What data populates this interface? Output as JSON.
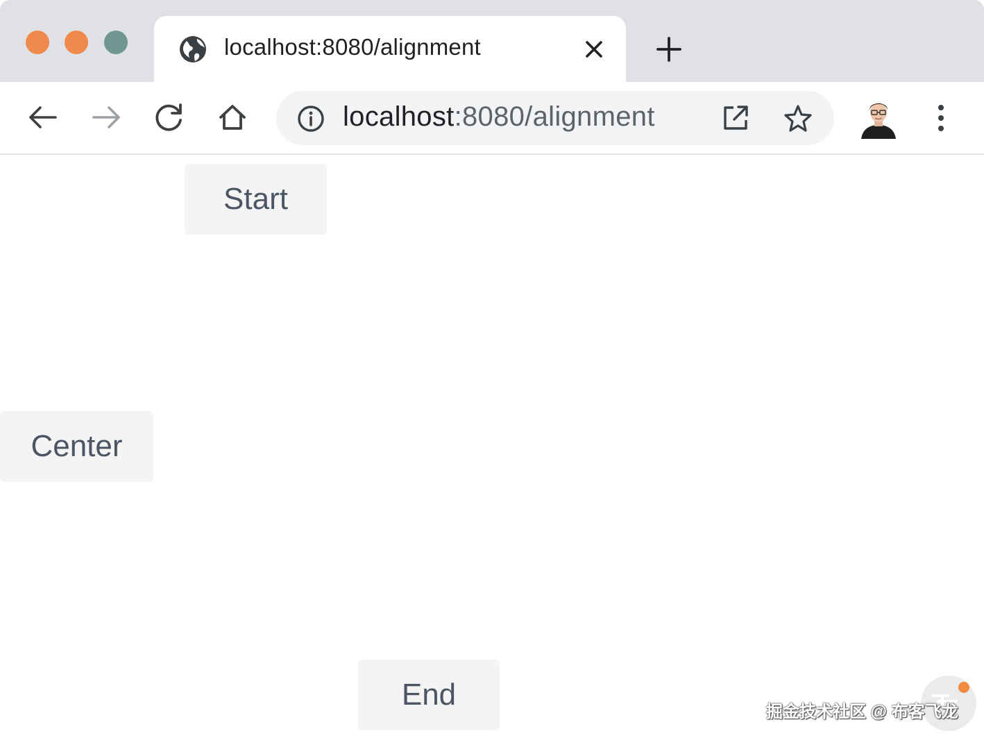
{
  "window": {
    "traffic_lights": [
      {
        "name": "close",
        "color": "#ef8a4c"
      },
      {
        "name": "minimize",
        "color": "#ef8a4c"
      },
      {
        "name": "zoom",
        "color": "#6f9690"
      }
    ]
  },
  "tab": {
    "title": "localhost:8080/alignment",
    "favicon": "globe-icon",
    "close_icon": "close-icon",
    "new_tab_icon": "plus-icon"
  },
  "toolbar": {
    "back_icon": "arrow-left-icon",
    "forward_icon": "arrow-right-icon",
    "reload_icon": "reload-icon",
    "home_icon": "home-icon",
    "omnibox": {
      "info_icon": "info-icon",
      "url_host": "localhost",
      "url_path": ":8080/alignment",
      "open_external_icon": "open-external-icon",
      "bookmark_icon": "star-icon"
    },
    "avatar": "profile-avatar",
    "menu_icon": "kebab-menu-icon"
  },
  "page": {
    "buttons": {
      "start": "Start",
      "center": "Center",
      "end": "End"
    },
    "button_bg": "#f4f4f5",
    "button_text_color": "#4b5563"
  },
  "watermark": {
    "text": "掘金技术社区 @ 布客飞龙",
    "logo": "juejin-logo"
  }
}
